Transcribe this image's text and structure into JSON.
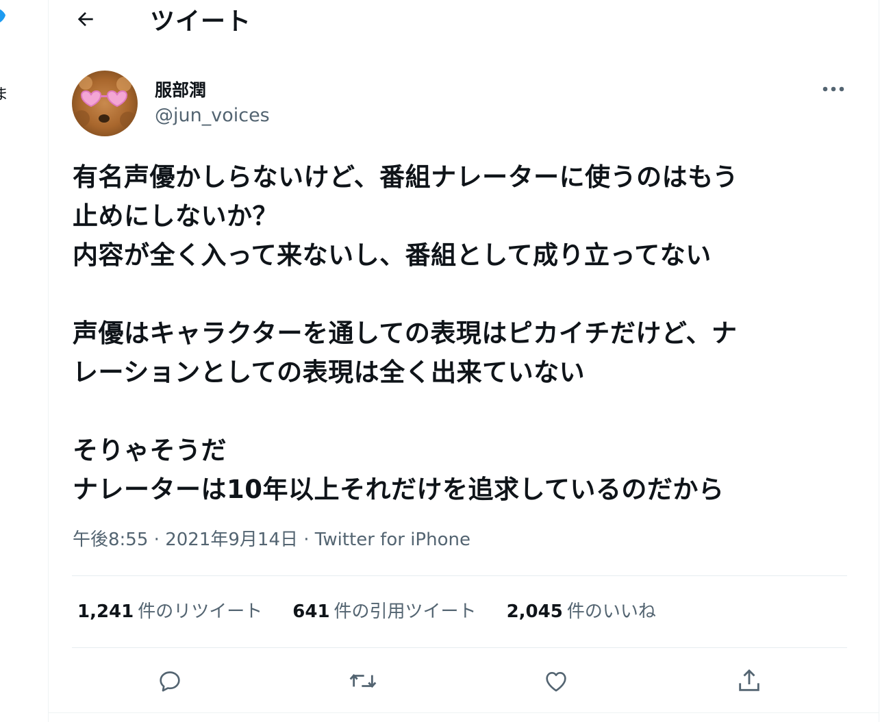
{
  "header": {
    "title": "ツイート"
  },
  "left_fragment": {
    "char_1": "ま",
    "char_2": "。"
  },
  "author": {
    "display_name": "服部潤",
    "handle": "@jun_voices"
  },
  "tweet": {
    "text": "有名声優かしらないけど、番組ナレーターに使うのはもう\n止めにしないか？\n内容が全く入って来ないし、番組として成り立ってない\n\n声優はキャラクターを通しての表現はピカイチだけど、ナ\nレーションとしての表現は全く出来ていない\n\nそりゃそうだ\nナレーターは10年以上それだけを追求しているのだから",
    "time": "午後8:55",
    "separator": " · ",
    "date": "2021年9月14日",
    "separator2": " · ",
    "source": "Twitter for iPhone"
  },
  "stats": {
    "retweets_count": "1,241",
    "retweets_label": "件のリツイート",
    "quotes_count": "641",
    "quotes_label": "件の引用ツイート",
    "likes_count": "2,045",
    "likes_label": "件のいいね"
  },
  "icons": {
    "back": "arrow-left-icon",
    "more": "more-horizontal-icon",
    "reply": "reply-icon",
    "retweet": "retweet-icon",
    "like": "heart-icon",
    "share": "share-icon",
    "logo": "twitter-bird-icon"
  },
  "colors": {
    "accent": "#1d9bf0",
    "text": "#0f1419",
    "secondary": "#536471",
    "divider": "#e6ecf0"
  }
}
